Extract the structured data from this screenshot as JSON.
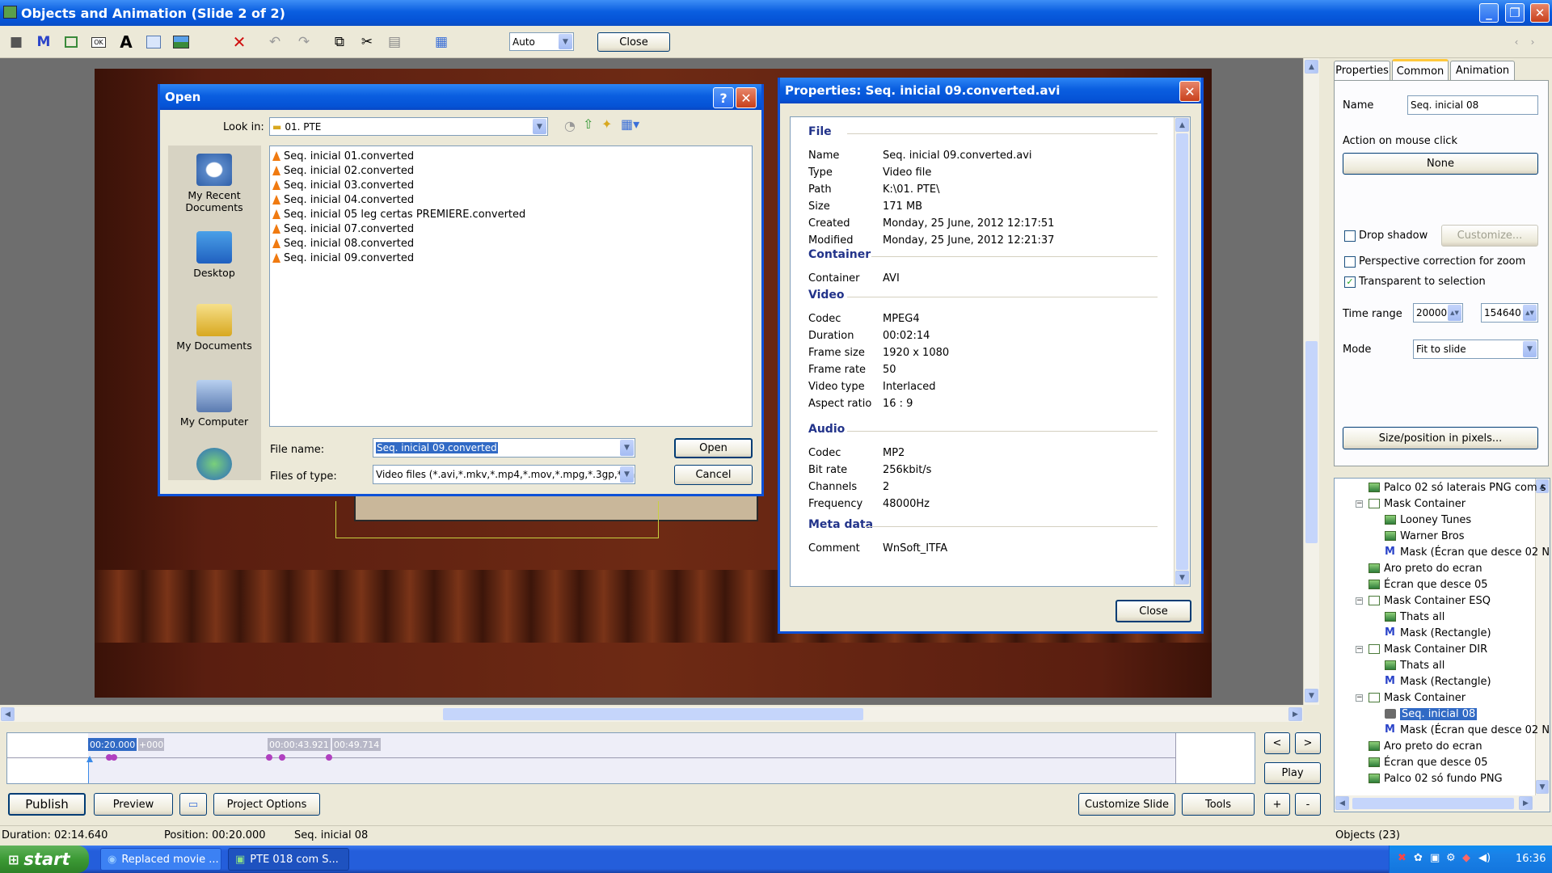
{
  "window": {
    "title": "Objects and Animation  (Slide 2 of 2)"
  },
  "toolbar": {
    "icons": [
      "camera-icon",
      "mask-icon",
      "rectangle-icon",
      "button-icon",
      "text-icon",
      "frame-icon",
      "image-icon",
      "delete-icon",
      "undo-icon",
      "redo-icon",
      "copy-icon",
      "cut-icon",
      "paste-icon",
      "grid-icon"
    ],
    "zoom_value": "Auto",
    "close_label": "Close"
  },
  "open_dialog": {
    "title": "Open",
    "look_in_label": "Look in:",
    "look_in_value": "01. PTE",
    "places": [
      "My Recent Documents",
      "Desktop",
      "My Documents",
      "My Computer",
      ""
    ],
    "files": [
      "Seq. inicial 01.converted",
      "Seq. inicial 02.converted",
      "Seq. inicial 03.converted",
      "Seq. inicial 04.converted",
      "Seq. inicial 05 leg certas PREMIERE.converted",
      "Seq. inicial 07.converted",
      "Seq. inicial 08.converted",
      "Seq. inicial 09.converted"
    ],
    "file_name_label": "File name:",
    "file_name_value": "Seq. inicial 09.converted",
    "files_of_type_label": "Files of type:",
    "files_of_type_value": "Video files (*.avi,*.mkv,*.mp4,*.mov,*.mpg,*.3gp,*.m",
    "open_label": "Open",
    "cancel_label": "Cancel"
  },
  "properties_dialog": {
    "title": "Properties: Seq. inicial 09.converted.avi",
    "sections": {
      "file": "File",
      "container": "Container",
      "video": "Video",
      "audio": "Audio",
      "meta": "Meta data"
    },
    "file_rows": [
      {
        "k": "Name",
        "v": "Seq. inicial 09.converted.avi"
      },
      {
        "k": "Type",
        "v": "Video file"
      },
      {
        "k": "Path",
        "v": "K:\\01. PTE\\"
      },
      {
        "k": "Size",
        "v": "171 MB"
      },
      {
        "k": "Created",
        "v": "Monday, 25 June, 2012  12:17:51"
      },
      {
        "k": "Modified",
        "v": "Monday, 25 June, 2012  12:21:37"
      }
    ],
    "container_rows": [
      {
        "k": "Container",
        "v": "AVI"
      }
    ],
    "video_rows": [
      {
        "k": "Codec",
        "v": "MPEG4"
      },
      {
        "k": "Duration",
        "v": "00:02:14"
      },
      {
        "k": "Frame size",
        "v": "1920 x 1080"
      },
      {
        "k": "Frame rate",
        "v": "50"
      },
      {
        "k": "Video type",
        "v": "Interlaced"
      },
      {
        "k": "Aspect ratio",
        "v": "16 : 9"
      }
    ],
    "audio_rows": [
      {
        "k": "Codec",
        "v": "MP2"
      },
      {
        "k": "Bit rate",
        "v": "256kbit/s"
      },
      {
        "k": "Channels",
        "v": "2"
      },
      {
        "k": "Frequency",
        "v": "48000Hz"
      }
    ],
    "meta_rows": [
      {
        "k": "Comment",
        "v": "WnSoft_ITFA"
      }
    ],
    "close_label": "Close"
  },
  "right_panel": {
    "tabs": [
      "Properties",
      "Common",
      "Animation"
    ],
    "active_tab": "Common",
    "name_label": "Name",
    "name_value": "Seq. inicial 08",
    "action_label": "Action on mouse click",
    "action_value": "None",
    "drop_shadow_label": "Drop shadow",
    "drop_shadow_checked": false,
    "customize_label": "Customize...",
    "perspective_label": "Perspective correction for zoom",
    "perspective_checked": false,
    "transparent_label": "Transparent to selection",
    "transparent_checked": true,
    "time_range_label": "Time range",
    "time_from": "20000",
    "time_to": "154640",
    "mode_label": "Mode",
    "mode_value": "Fit to slide",
    "size_button_label": "Size/position in pixels..."
  },
  "object_tree": [
    {
      "label": "Palco 02 só laterais PNG com s",
      "level": 0,
      "icon": "image"
    },
    {
      "label": "Mask Container",
      "level": 0,
      "icon": "container",
      "toggle": "−"
    },
    {
      "label": "Looney Tunes",
      "level": 1,
      "icon": "image"
    },
    {
      "label": "Warner Bros",
      "level": 1,
      "icon": "image"
    },
    {
      "label": "Mask (Écran que desce 02 N",
      "level": 1,
      "icon": "mask"
    },
    {
      "label": "Aro preto do ecran",
      "level": 0,
      "icon": "image"
    },
    {
      "label": "Écran que desce 05",
      "level": 0,
      "icon": "image"
    },
    {
      "label": "Mask Container ESQ",
      "level": 0,
      "icon": "container",
      "toggle": "−"
    },
    {
      "label": "Thats all",
      "level": 1,
      "icon": "image"
    },
    {
      "label": "Mask (Rectangle)",
      "level": 1,
      "icon": "mask"
    },
    {
      "label": "Mask Container DIR",
      "level": 0,
      "icon": "container",
      "toggle": "−"
    },
    {
      "label": "Thats all",
      "level": 1,
      "icon": "image"
    },
    {
      "label": "Mask (Rectangle)",
      "level": 1,
      "icon": "mask"
    },
    {
      "label": "Mask Container",
      "level": 0,
      "icon": "container",
      "toggle": "−"
    },
    {
      "label": "Seq. inicial 08",
      "level": 1,
      "icon": "video",
      "selected": true
    },
    {
      "label": "Mask (Écran que desce 02 N",
      "level": 1,
      "icon": "mask"
    },
    {
      "label": "Aro preto do ecran",
      "level": 0,
      "icon": "image"
    },
    {
      "label": "Écran que desce 05",
      "level": 0,
      "icon": "image"
    },
    {
      "label": "Palco 02 só fundo PNG",
      "level": 0,
      "icon": "image"
    }
  ],
  "timeline": {
    "marker1": "00:20.000",
    "marker1_tail": "+000",
    "marker2": "00:00:43.921",
    "marker3": "00:49.714"
  },
  "nav": {
    "prev": "<",
    "next": ">",
    "play": "Play",
    "plus": "+",
    "minus": "-"
  },
  "bottom_buttons": {
    "publish": "Publish",
    "preview": "Preview",
    "project_options": "Project Options",
    "customize_slide": "Customize Slide",
    "tools": "Tools"
  },
  "status": {
    "duration": "Duration:  02:14.640",
    "position": "Position:  00:20.000",
    "object": "Seq. inicial 08",
    "objects_count": "Objects (23)"
  },
  "taskbar": {
    "start": "start",
    "tasks": [
      "Replaced movie ...",
      "PTE 018 com S..."
    ],
    "clock": "16:36"
  }
}
